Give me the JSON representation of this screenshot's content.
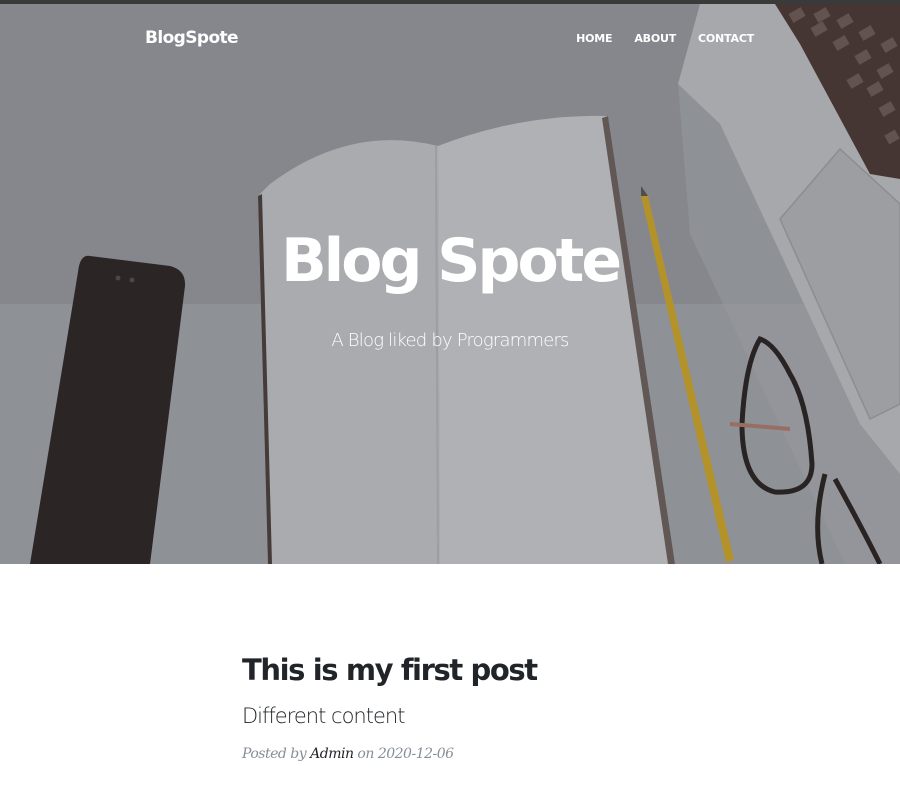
{
  "navbar": {
    "brand": "BlogSpote",
    "links": [
      {
        "label": "HOME"
      },
      {
        "label": "ABOUT"
      },
      {
        "label": "CONTACT"
      }
    ]
  },
  "header": {
    "title": "Blog Spote",
    "subtitle": "A Blog liked by Programmers"
  },
  "post": {
    "title": "This is my first post",
    "subtitle": "Different content",
    "meta_prefix": "Posted by",
    "author": "Admin",
    "meta_on": "on",
    "date": "2020-12-06"
  },
  "colors": {
    "text_dark": "#212529",
    "meta_gray": "#868e96",
    "header_text": "#ffffff"
  }
}
